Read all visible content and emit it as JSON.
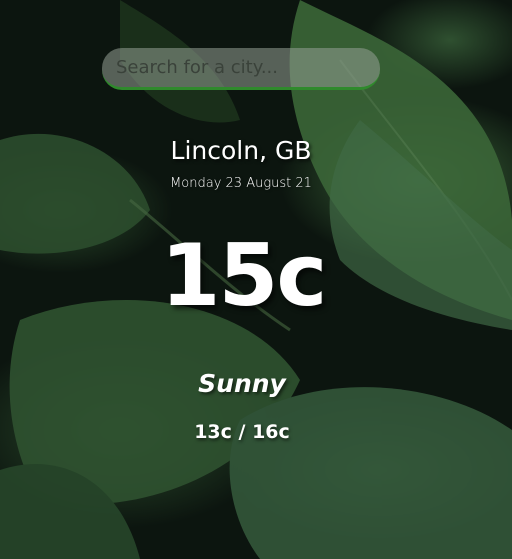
{
  "search": {
    "placeholder": "Search for a city...",
    "value": ""
  },
  "location": {
    "city_country": "Lincoln, GB",
    "date": "Monday 23 August 21"
  },
  "weather": {
    "temperature": "15c",
    "condition": "Sunny",
    "min_max": "13c / 16c"
  },
  "colors": {
    "accent": "#2f8a2c",
    "text": "#ffffff",
    "leaf_background": "#2d4f2e"
  }
}
